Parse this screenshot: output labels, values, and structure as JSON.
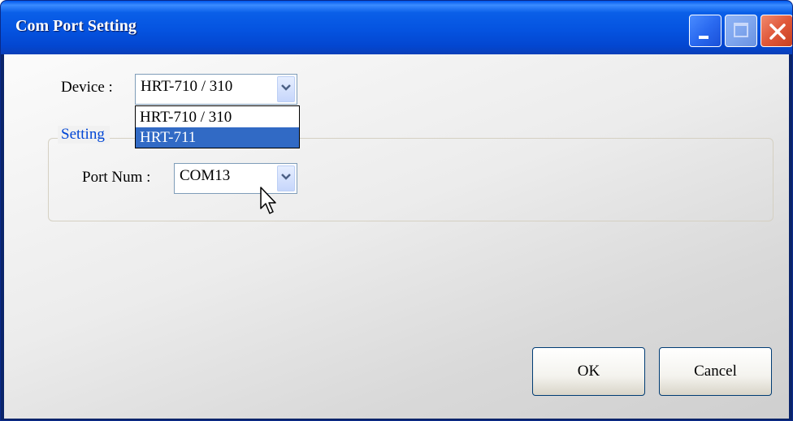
{
  "window": {
    "title": "Com Port Setting",
    "controls": [
      "minimize-icon",
      "maximize-icon",
      "close-icon"
    ]
  },
  "device": {
    "label": "Device :",
    "selected": "HRT-710 / 310",
    "options": [
      "HRT-710 / 310",
      "HRT-711"
    ],
    "highlighted": "HRT-711"
  },
  "setting": {
    "group_label": "Setting",
    "port_label": "Port Num :",
    "port_value": "COM13"
  },
  "buttons": {
    "ok": "OK",
    "cancel": "Cancel"
  },
  "colors": {
    "title_bar": "#0553e0",
    "highlight": "#316ac5",
    "group_label": "#0046d5"
  }
}
